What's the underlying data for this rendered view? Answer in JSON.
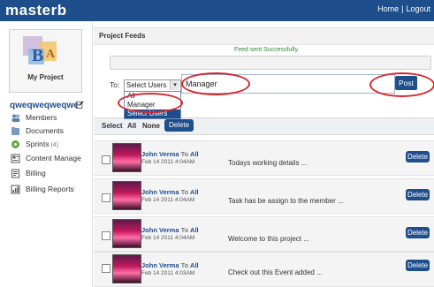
{
  "app": {
    "logo": "masterb"
  },
  "topnav": {
    "home": "Home",
    "separator": "|",
    "logout": "Logout"
  },
  "project": {
    "label": "My Project",
    "name": "qweqweqweqwe"
  },
  "sidebar": {
    "items": [
      {
        "label": "Members",
        "icon": "members-icon"
      },
      {
        "label": "Documents",
        "icon": "documents-icon"
      },
      {
        "label": "Sprints",
        "count": "(4)",
        "icon": "sprints-icon"
      },
      {
        "label": "Content Manage",
        "icon": "content-manage-icon"
      },
      {
        "label": "Billing",
        "icon": "billing-icon"
      },
      {
        "label": "Billing Reports",
        "icon": "billing-reports-icon"
      }
    ]
  },
  "feeds": {
    "title": "Project Feeds",
    "success": "Feed sent Successfully.",
    "to_label": "To:",
    "select_value": "Select Users",
    "dropdown": [
      "All",
      "Manager",
      "Select Users"
    ],
    "message_value": "Manager",
    "post_label": "Post"
  },
  "actions": {
    "select": "Select",
    "all": "All",
    "none": "None",
    "delete": "Delete"
  },
  "feed_items": [
    {
      "author": "John Verma",
      "to": "To",
      "target": "All",
      "date": "Feb 14 2011 4:04AM",
      "message": "Todays working details ...",
      "delete": "Delete"
    },
    {
      "author": "John Verma",
      "to": "To",
      "target": "All",
      "date": "Feb 14 2011 4:04AM",
      "message": "Task has be assign to the member ...",
      "delete": "Delete"
    },
    {
      "author": "John Verma",
      "to": "To",
      "target": "All",
      "date": "Feb 14 2011 4:04AM",
      "message": "Welcome to this project ...",
      "delete": "Delete"
    },
    {
      "author": "John Verma",
      "to": "To",
      "target": "All",
      "date": "Feb 14 2011 4:03AM",
      "message": "Check out this Event added ...",
      "delete": "Delete"
    }
  ],
  "colors": {
    "brand": "#1f4e8d",
    "annotation": "#d9262c",
    "success": "#2c8a2c"
  }
}
